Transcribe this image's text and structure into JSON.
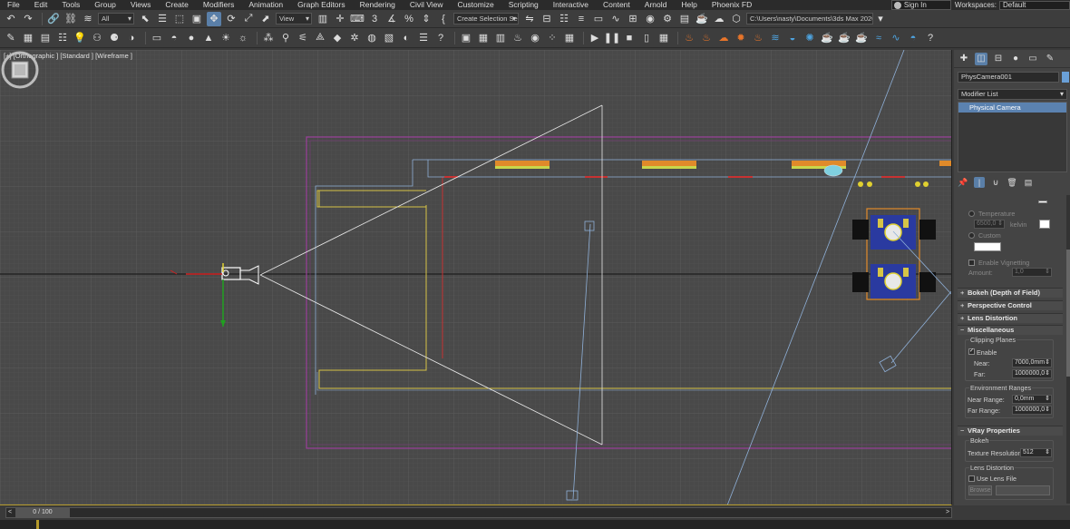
{
  "menu": {
    "items": [
      "File",
      "Edit",
      "Tools",
      "Group",
      "Views",
      "Create",
      "Modifiers",
      "Animation",
      "Graph Editors",
      "Rendering",
      "Civil View",
      "Customize",
      "Scripting",
      "Interactive",
      "Content",
      "Arnold",
      "Help",
      "Phoenix FD"
    ],
    "sign_in": "Sign In",
    "workspaces_label": "Workspaces:",
    "workspace_value": "Default"
  },
  "toolbar": {
    "filter_value": "All",
    "coord_value": "View",
    "selection_set": "Create Selection Se",
    "project_path": "C:\\Users\\nasty\\Documents\\3ds Max 2020"
  },
  "viewport": {
    "label": "[+] [Orthographic ] [Standard ] [Wireframe ]"
  },
  "command_panel": {
    "object_name": "PhysCamera001",
    "modifier_list": "Modifier List",
    "stack_item": "Physical Camera",
    "color_swatch": "#6aa0d8",
    "temperature_label": "Temperature",
    "temperature_value": "6500,0",
    "temperature_unit": "kelvin",
    "custom_label": "Custom",
    "enable_vignetting": "Enable Vignetting",
    "amount_label": "Amount:",
    "amount_value": "1,0",
    "rollouts": {
      "bokeh": "Bokeh (Depth of Field)",
      "perspective": "Perspective Control",
      "lens_distortion": "Lens Distortion",
      "misc": "Miscellaneous",
      "vray": "VRay Properties"
    },
    "clipping_planes": "Clipping Planes",
    "enable_label": "Enable",
    "near_label": "Near:",
    "near_value": "7000,0mm",
    "far_label": "Far:",
    "far_value": "1000000,0",
    "env_ranges": "Environment Ranges",
    "near_range_label": "Near Range:",
    "near_range_value": "0,0mm",
    "far_range_label": "Far Range:",
    "far_range_value": "1000000,0",
    "vray_bokeh": "Bokeh",
    "texture_res_label": "Texture Resolution",
    "texture_res_value": "512",
    "vray_lens_distortion": "Lens Distortion",
    "use_lens_file": "Use Lens File",
    "browse": "Browse"
  },
  "timeline": {
    "frame": "0 / 100",
    "left_arrow": "<",
    "right_arrow": ">"
  }
}
